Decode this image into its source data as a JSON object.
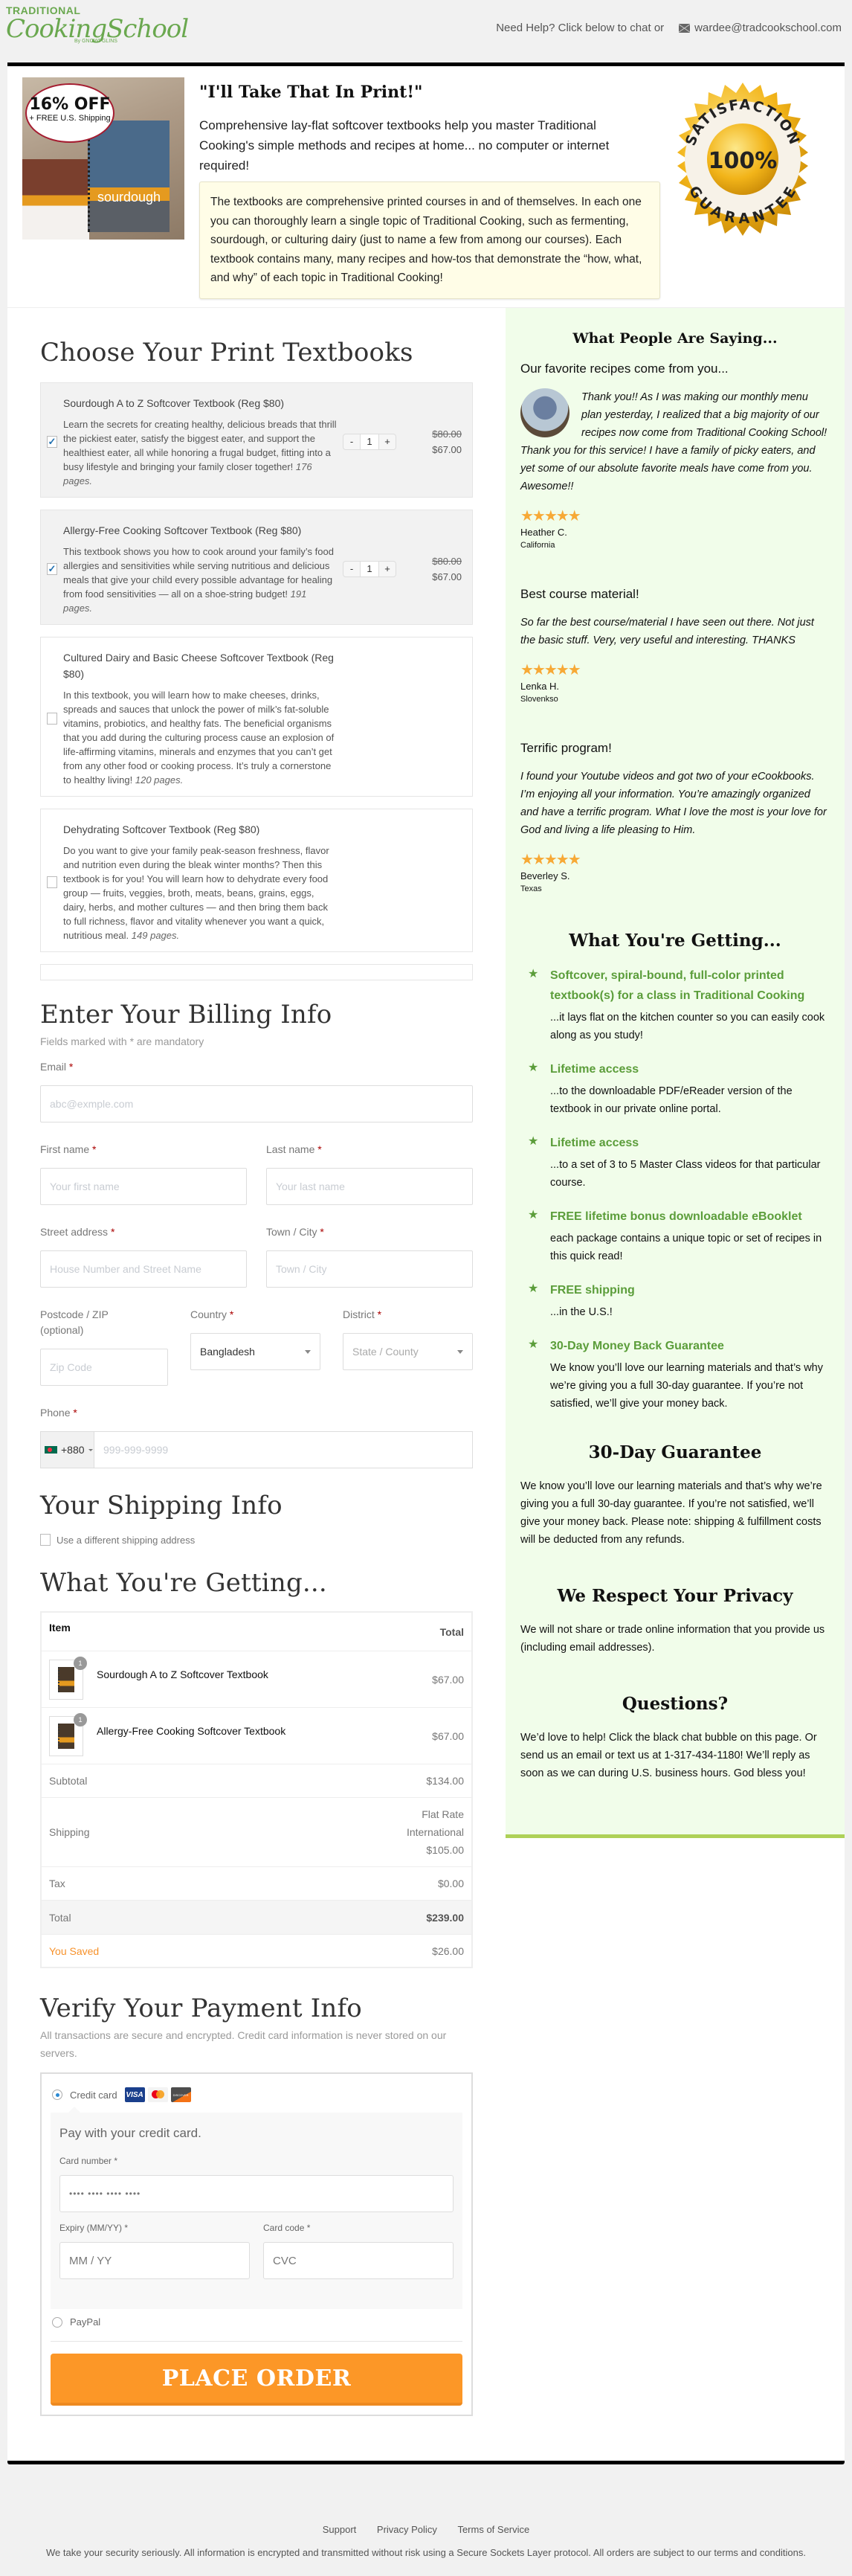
{
  "header": {
    "logo": {
      "line1": "TRADITIONAL",
      "line2": "CookingSchool",
      "line3": "By GNOWFGLINS"
    },
    "help_text": "Need Help? Click below to chat or",
    "email": "wardee@tradcookschool.com"
  },
  "hero": {
    "badge_pct": "16% OFF",
    "badge_shipping": "+ FREE U.S. Shipping",
    "book_label": "sourdough",
    "title": "\"I'll Take That In Print!\"",
    "subtitle": "Comprehensive lay-flat softcover textbooks help you master Traditional Cooking's simple methods and recipes at home... no computer or internet required!",
    "box_text": "The textbooks are comprehensive printed courses in and of themselves. In each one you can thoroughly learn a single topic of Traditional Cooking, such as fermenting, sourdough, or culturing dairy (just to name a few from among our courses). Each textbook contains many, many recipes and how-tos that demonstrate the “how, what, and why” of each topic in Traditional Cooking!",
    "seal": {
      "top": "SATISFACTION",
      "mid": "100%",
      "bottom": "GUARANTEE"
    }
  },
  "products_section": {
    "title": "Choose Your Print Textbooks",
    "products": [
      {
        "title": "Sourdough A to Z Softcover Textbook (Reg $80)",
        "desc": "Learn the secrets for creating healthy, delicious breads that thrill the pickiest eater, satisfy the biggest eater, and support the healthiest eater, all while honoring a frugal budget, fitting into a busy lifestyle and bringing your family closer together!",
        "pages": "176 pages.",
        "checked": true,
        "qty": "1",
        "regular_price": "$80.00",
        "sale_price": "$67.00"
      },
      {
        "title": "Allergy-Free Cooking Softcover Textbook (Reg $80)",
        "desc": "This textbook shows you how to cook around your family’s food allergies and sensitivities while serving nutritious and delicious meals that give your child every possible advantage for healing from food sensitivities — all on a shoe-string budget!",
        "pages": "191 pages.",
        "checked": true,
        "qty": "1",
        "regular_price": "$80.00",
        "sale_price": "$67.00"
      },
      {
        "title": "Cultured Dairy and Basic Cheese Softcover Textbook (Reg $80)",
        "desc": "In this textbook, you will learn how to make cheeses, drinks, spreads and sauces that unlock the power of milk’s fat-soluble vitamins, probiotics, and healthy fats. The beneficial organisms that you add during the culturing process cause an explosion of life-affirming vitamins, minerals and enzymes that you can’t get from any other food or cooking process. It’s truly a cornerstone to healthy living!",
        "pages": "120 pages.",
        "checked": false
      },
      {
        "title": "Dehydrating Softcover Textbook (Reg $80)",
        "desc": "Do you want to give your family peak-season freshness, flavor and nutrition even during the bleak winter months? Then this textbook is for you! You will learn how to dehydrate every food group — fruits, veggies, broth, meats, beans, grains, eggs, dairy, herbs, and mother cultures — and then bring them back to full richness, flavor and vitality whenever you want a quick, nutritious meal.",
        "pages": "149 pages.",
        "checked": false
      }
    ],
    "qty_minus": "-",
    "qty_plus": "+"
  },
  "billing": {
    "title": "Enter Your Billing Info",
    "hint": "Fields marked with * are mandatory",
    "req": "*",
    "email_label": "Email",
    "email_placeholder": "abc@exmple.com",
    "first_label": "First name",
    "first_placeholder": "Your first name",
    "last_label": "Last name",
    "last_placeholder": "Your last name",
    "street_label": "Street address",
    "street_placeholder": "House Number and Street Name",
    "city_label": "Town / City",
    "city_placeholder": "Town / City",
    "zip_label": "Postcode / ZIP (optional)",
    "zip_placeholder": "Zip Code",
    "country_label": "Country",
    "country_value": "Bangladesh",
    "district_label": "District",
    "district_placeholder": "State / County",
    "phone_label": "Phone",
    "phone_code": "+880",
    "phone_placeholder": "999-999-9999"
  },
  "shipping": {
    "title": "Your Shipping Info",
    "checkbox_label": "Use a different shipping address"
  },
  "order": {
    "title": "What You're Getting...",
    "col_item": "Item",
    "col_total": "Total",
    "items": [
      {
        "name": "Sourdough A to Z Softcover Textbook",
        "qty": "1",
        "total": "$67.00"
      },
      {
        "name": "Allergy-Free Cooking Softcover Textbook",
        "qty": "1",
        "total": "$67.00"
      }
    ],
    "subtotal_label": "Subtotal",
    "subtotal": "$134.00",
    "shipping_label": "Shipping",
    "shipping_method1": "Flat Rate",
    "shipping_method2": "International",
    "shipping_cost": "$105.00",
    "tax_label": "Tax",
    "tax": "$0.00",
    "total_label": "Total",
    "total": "$239.00",
    "saved_label": "You Saved",
    "saved": "$26.00"
  },
  "payment": {
    "title": "Verify Your Payment Info",
    "note": "All transactions are secure and encrypted. Credit card information is never stored on our servers.",
    "credit_label": "Credit card",
    "cards": [
      "VISA",
      "",
      "DISCOVER"
    ],
    "panel_text": "Pay with your credit card.",
    "card_number_label": "Card number *",
    "card_number_placeholder": "•••• •••• •••• ••••",
    "expiry_label": "Expiry (MM/YY) *",
    "expiry_placeholder": "MM / YY",
    "cvc_label": "Card code *",
    "cvc_placeholder": "CVC",
    "paypal_label": "PayPal",
    "place_order": "PLACE ORDER"
  },
  "sidebar": {
    "testimonials_title": "What People Are Saying...",
    "reviews": [
      {
        "headline": "Our favorite recipes come from you...",
        "text": "Thank you!! As I was making our monthly menu plan yesterday, I realized that a big majority of our recipes now come from Traditional Cooking School! Thank you for this service! I have a family of picky eaters, and yet some of our absolute favorite meals have come from you. Awesome!!",
        "stars": "★★★★★",
        "name": "Heather C.",
        "location": "California"
      },
      {
        "headline": "Best course material!",
        "text": "So far the best course/material I have seen out there. Not just the basic stuff. Very, very useful and interesting. THANKS",
        "stars": "★★★★★",
        "name": "Lenka H.",
        "location": "Slovenkso"
      },
      {
        "headline": "Terrific program!",
        "text": "I found your Youtube videos and got two of your eCookbooks. I’m enjoying all your information. You’re amazingly organized and have a terrific program. What I love the most is your love for God and living a life pleasing to Him.",
        "stars": "★★★★★",
        "name": "Beverley S.",
        "location": "Texas"
      }
    ],
    "benefits_title": "What You're Getting...",
    "benefits": [
      {
        "title": "Softcover, spiral-bound, full-color printed textbook(s) for a class in Traditional Cooking",
        "desc": "...it lays flat on the kitchen counter so you can easily cook along as you study!"
      },
      {
        "title": "Lifetime access",
        "desc": "...to the downloadable PDF/eReader version of the textbook in our private online portal."
      },
      {
        "title": "Lifetime access",
        "desc": "...to a set of 3 to 5 Master Class videos for that particular course."
      },
      {
        "title": "FREE lifetime bonus downloadable eBooklet",
        "desc": "each package contains a unique topic or set of recipes in this quick read!"
      },
      {
        "title": "FREE shipping",
        "desc": "...in the U.S.!"
      },
      {
        "title": "30-Day Money Back Guarantee",
        "desc": "We know you’ll love our learning materials and that’s why we’re giving you a full 30-day guarantee. If you’re not satisfied, we’ll give your money back."
      }
    ],
    "guarantee_title": "30-Day Guarantee",
    "guarantee_text": "We know you’ll love our learning materials and that’s why we’re giving you a full 30-day guarantee. If you’re not satisfied, we’ll give your money back. Please note: shipping & fulfillment costs will be deducted from any refunds.",
    "privacy_title": "We Respect Your Privacy",
    "privacy_text": "We will not share or trade online information that you provide us (including email addresses).",
    "questions_title": "Questions?",
    "questions_text": "We’d love to help! Click the black chat bubble on this page. Or send us an email or text us at 1-317-434-1180! We’ll reply as soon as we can during U.S. business hours. God bless you!"
  },
  "footer": {
    "links": [
      "Support",
      "Privacy Policy",
      "Terms of Service"
    ],
    "security_note": "We take your security seriously. All information is encrypted and transmitted without risk using a Secure Sockets Layer protocol. All orders are subject to our terms and conditions."
  },
  "colors": {
    "accent_green": "#5b9d3a",
    "sidebar_bg": "#f1fdea",
    "order_button": "#fc9727",
    "saved_label": "#f7922b"
  }
}
